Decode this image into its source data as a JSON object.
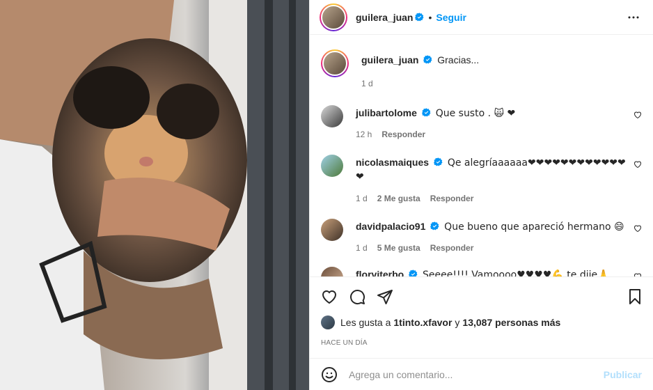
{
  "colors": {
    "accent": "#0095f6",
    "text": "#262626",
    "muted": "#737373",
    "heart": "#ed4956",
    "publish_disabled": "#b2dffc"
  },
  "photo": {
    "image_label": "Man hugging a tricolor Persian cat"
  },
  "header": {
    "username": "guilera_juan",
    "separator": "•",
    "follow_label": "Seguir",
    "more_icon": "more-horizontal-icon"
  },
  "caption": {
    "username": "guilera_juan",
    "text": "Gracias...",
    "time": "1 d"
  },
  "comments": [
    {
      "username": "julibartolome",
      "text": "Que susto . 🙀 ❤",
      "time": "12 h",
      "likes": "",
      "reply": "Responder"
    },
    {
      "username": "nicolasmaiques",
      "text": "Qe alegríaaaaaa❤❤❤❤❤❤❤❤❤❤❤❤❤",
      "time": "1 d",
      "likes": "2 Me gusta",
      "reply": "Responder"
    },
    {
      "username": "davidpalacio91",
      "text": "Que bueno que apareció hermano 😄",
      "time": "1 d",
      "likes": "5 Me gusta",
      "reply": "Responder"
    },
    {
      "username": "florviterbo",
      "text": "Seeee!!!! Vamoooo♥♥♥♥💪 te dije🙏",
      "time": "",
      "likes": "",
      "reply": ""
    }
  ],
  "likes": {
    "prefix": "Les gusta a ",
    "user": "1tinto.xfavor",
    "middle": " y ",
    "count": "13,087 personas más"
  },
  "posted": "HACE UN DÍA",
  "composer": {
    "placeholder": "Agrega un comentario...",
    "publish_label": "Publicar"
  }
}
